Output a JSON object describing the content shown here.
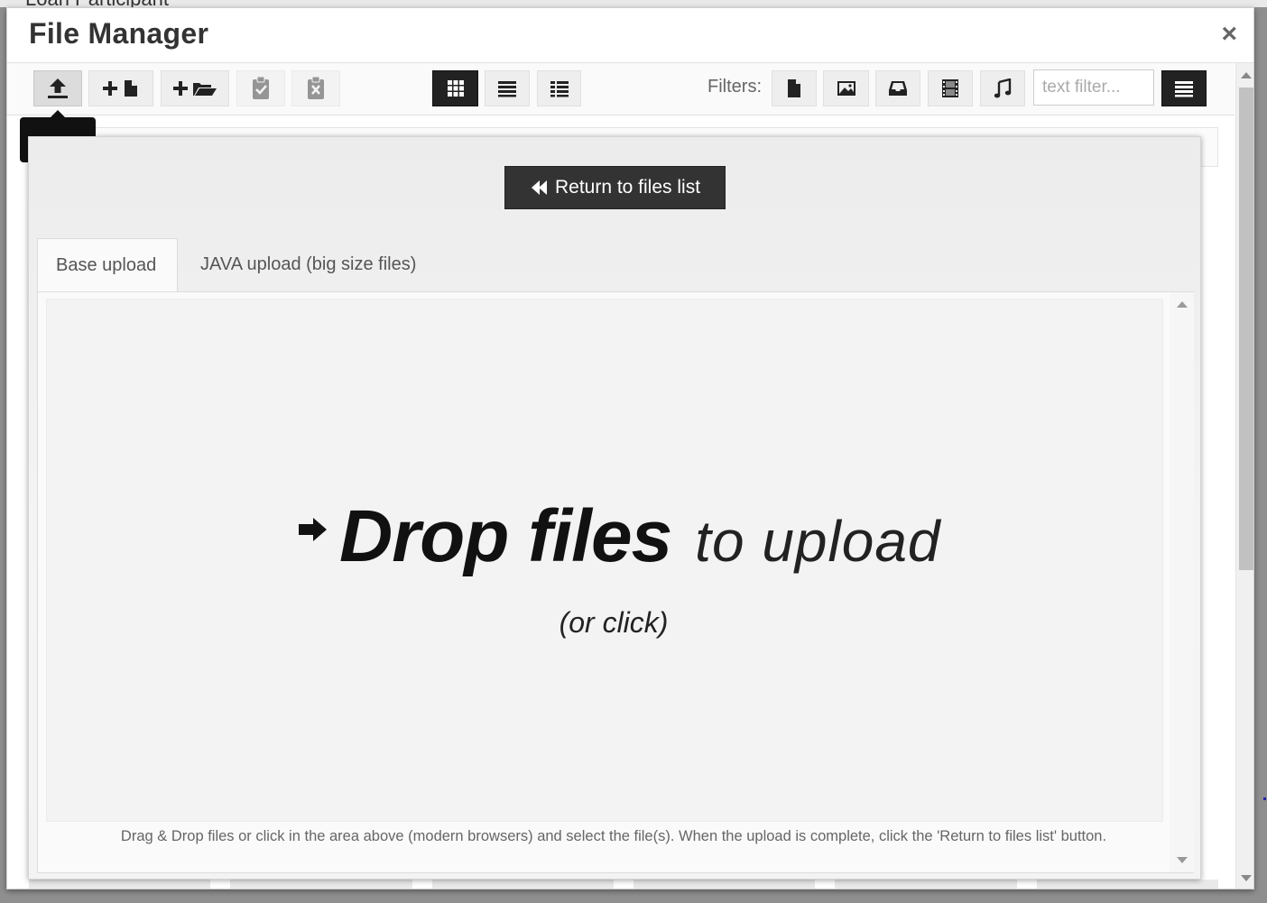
{
  "background": {
    "partial_text": "Loan Participant"
  },
  "modal": {
    "title": "File Manager",
    "close_glyph": "×"
  },
  "toolbar": {
    "buttons": [
      {
        "name": "upload-button",
        "icon": "upload-icon",
        "state": "active"
      },
      {
        "name": "new-file-button",
        "icon": "plus-file-icon",
        "state": "normal"
      },
      {
        "name": "new-folder-button",
        "icon": "plus-folder-icon",
        "state": "normal"
      },
      {
        "name": "paste-button",
        "icon": "clipboard-check-icon",
        "state": "disabled"
      },
      {
        "name": "clear-clipboard-button",
        "icon": "clipboard-x-icon",
        "state": "disabled"
      },
      {
        "name": "view-grid-button",
        "icon": "grid-icon",
        "state": "selected"
      },
      {
        "name": "view-list-button",
        "icon": "list-icon",
        "state": "normal"
      },
      {
        "name": "view-columns-button",
        "icon": "columns-icon",
        "state": "normal"
      }
    ],
    "filters_label": "Filters:",
    "filters": [
      {
        "name": "filter-file",
        "icon": "file-icon"
      },
      {
        "name": "filter-image",
        "icon": "image-icon"
      },
      {
        "name": "filter-archive",
        "icon": "archive-icon"
      },
      {
        "name": "filter-video",
        "icon": "film-icon"
      },
      {
        "name": "filter-audio",
        "icon": "music-icon"
      }
    ],
    "text_filter_placeholder": "text filter...",
    "menu_icon": "hamburger-icon"
  },
  "upload_panel": {
    "return_label": "Return to files list",
    "tabs": [
      {
        "label": "Base upload",
        "active": true
      },
      {
        "label": "JAVA upload (big size files)",
        "active": false
      }
    ],
    "drop_big": "Drop files",
    "drop_small": "to upload",
    "drop_sub": "(or click)",
    "help_text": "Drag & Drop files or click in the area above (modern browsers) and select the file(s). When the upload is complete, click the 'Return to files list' button."
  },
  "colors": {
    "dark_button": "#333333",
    "toolbar_bg": "#fafafa",
    "drop_zone_bg": "#f3f3f3"
  }
}
